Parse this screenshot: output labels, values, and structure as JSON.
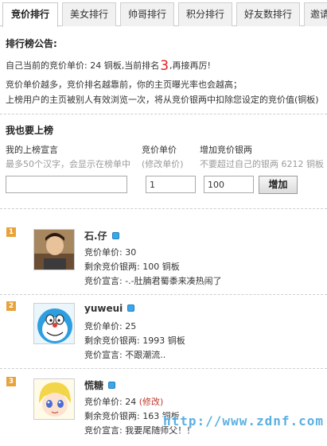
{
  "tabs": [
    "竞价排行",
    "美女排行",
    "帅哥排行",
    "积分排行",
    "好友数排行",
    "邀请"
  ],
  "notice": {
    "title": "排行榜公告:",
    "line1_prefix": "自己当前的竞价单价: 24 铜板,当前排名",
    "rank": "3",
    "line1_suffix": ",再接再厉!",
    "line2": "竞价单价越多，竞价排名越靠前，你的主页曝光率也会越高；",
    "line3": "上榜用户的主页被别人有效浏览一次，将从竞价银两中扣除您设定的竞价值(铜板)"
  },
  "form": {
    "title": "我也要上榜",
    "declaration_label": "我的上榜宣言",
    "declaration_hint": "最多50个汉字，会显示在榜单中",
    "bid_label": "竞价单价",
    "bid_hint": "(修改单价)",
    "add_label": "增加竞价银两",
    "add_hint": "不要超过自己的银两  6212 铜板",
    "bid_value": "1",
    "add_value": "100",
    "submit_label": "增加"
  },
  "ranking": [
    {
      "rank": "1",
      "name": "石.仔",
      "bid": "竞价单价: 30",
      "balance": "剩余竞价银两: 100 铜板",
      "slogan": "竞价宣言: -.-肚腩君蜀黍来凑热闹了",
      "edit": ""
    },
    {
      "rank": "2",
      "name": "yuweui",
      "bid": "竞价单价: 25",
      "balance": "剩余竞价银两: 1993 铜板",
      "slogan": "竞价宣言: 不跟潮流..",
      "edit": ""
    },
    {
      "rank": "3",
      "name": "慌糖",
      "bid": "竞价单价: 24",
      "balance": "剩余竞价银两: 163 铜板",
      "slogan": "竞价宣言: 我要尾随师父！！",
      "edit": "(修改)"
    }
  ],
  "watermark": "http://www.zdnf.com",
  "colors": {
    "rank_red": "#e02020",
    "badge": "#e8a23a",
    "vip_blue": "#3aa8e8"
  }
}
